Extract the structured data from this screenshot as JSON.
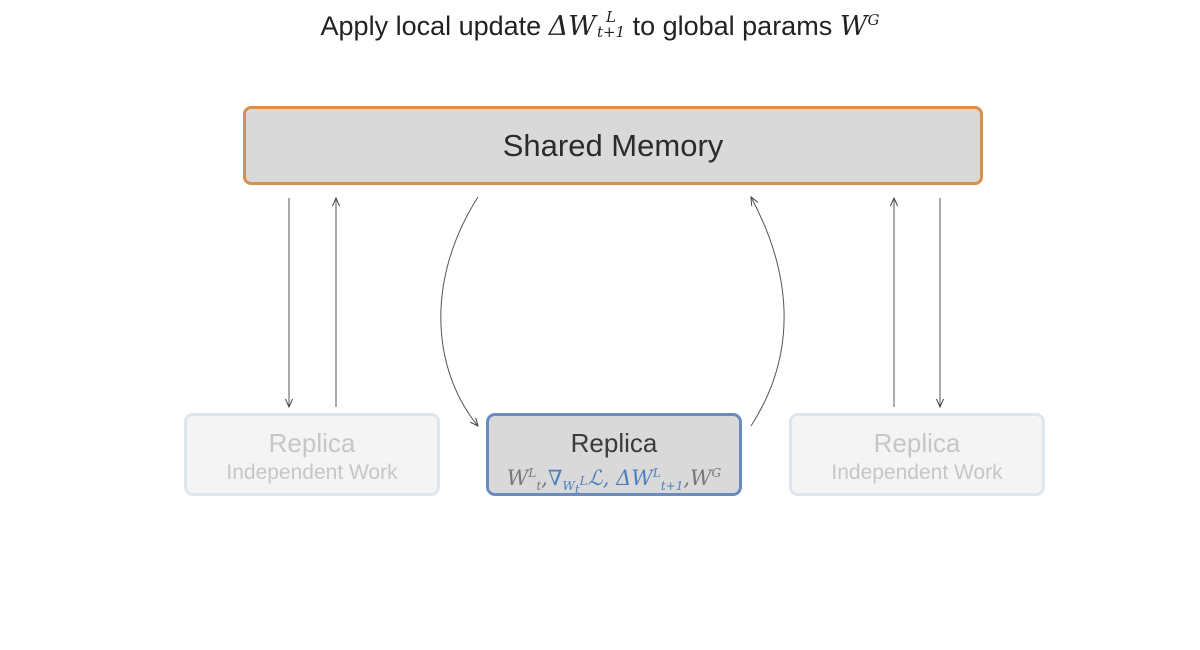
{
  "title": {
    "prefix": "Apply local update ",
    "delta_sym": "ΔW",
    "delta_sup": "L",
    "delta_sub": "t+1",
    "middle": " to global params ",
    "global_sym": "W",
    "global_sup": "G"
  },
  "shared_memory": {
    "label": "Shared Memory"
  },
  "replicas": [
    {
      "label": "Replica",
      "sublabel": "Independent Work"
    },
    {
      "label": "Replica",
      "math": {
        "w_local": "W",
        "w_local_sub": "t",
        "w_local_sup": "L",
        "sep1": ",",
        "grad": "∇",
        "grad_sub": "W",
        "grad_sub_sub": "t",
        "grad_sub_sup": "L",
        "loss": "ℒ",
        "sep2": ", ",
        "delta": "ΔW",
        "delta_sub": "t+1",
        "delta_sup": "L",
        "sep3": ",",
        "w_global": "W",
        "w_global_sup": "G"
      }
    },
    {
      "label": "Replica",
      "sublabel": "Independent Work"
    }
  ],
  "colors": {
    "shared_border": "#d9904a",
    "active_border": "#6a8cbf",
    "faded_border": "#dfe5ef",
    "math_blue": "#4f7fbf",
    "math_gray": "#777777"
  }
}
